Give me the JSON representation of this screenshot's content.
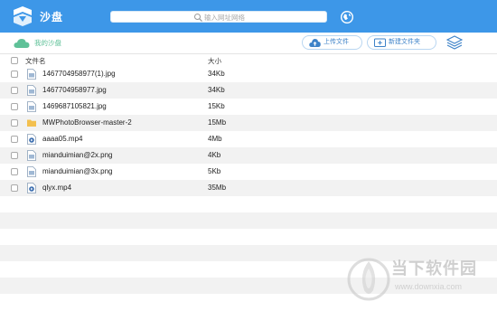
{
  "header": {
    "app_title": "沙盘",
    "address_placeholder": "输入网址网络"
  },
  "toolbar": {
    "my_disk_label": "我的沙盘",
    "upload_label": "上传文件",
    "new_folder_label": "新建文件夹"
  },
  "table": {
    "columns": {
      "name": "文件名",
      "size": "大小"
    },
    "rows": [
      {
        "name": "1467704958977(1).jpg",
        "size": "34Kb",
        "icon": "image-file-icon"
      },
      {
        "name": "1467704958977.jpg",
        "size": "34Kb",
        "icon": "image-file-icon"
      },
      {
        "name": "1469687105821.jpg",
        "size": "15Kb",
        "icon": "image-file-icon"
      },
      {
        "name": "MWPhotoBrowser-master-2",
        "size": "15Mb",
        "icon": "folder-icon"
      },
      {
        "name": "aaaa05.mp4",
        "size": "4Mb",
        "icon": "video-file-icon"
      },
      {
        "name": "mianduimian@2x.png",
        "size": "4Kb",
        "icon": "image-file-icon"
      },
      {
        "name": "mianduimian@3x.png",
        "size": "5Kb",
        "icon": "image-file-icon"
      },
      {
        "name": "qlyx.mp4",
        "size": "35Mb",
        "icon": "video-file-icon"
      }
    ]
  },
  "watermark": {
    "name": "当下软件园",
    "url": "www.downxia.com"
  },
  "colors": {
    "header": "#3d97e8",
    "accent_green": "#5fc198",
    "button_text": "#3d82c8",
    "row_stripe": "#f2f2f2"
  }
}
